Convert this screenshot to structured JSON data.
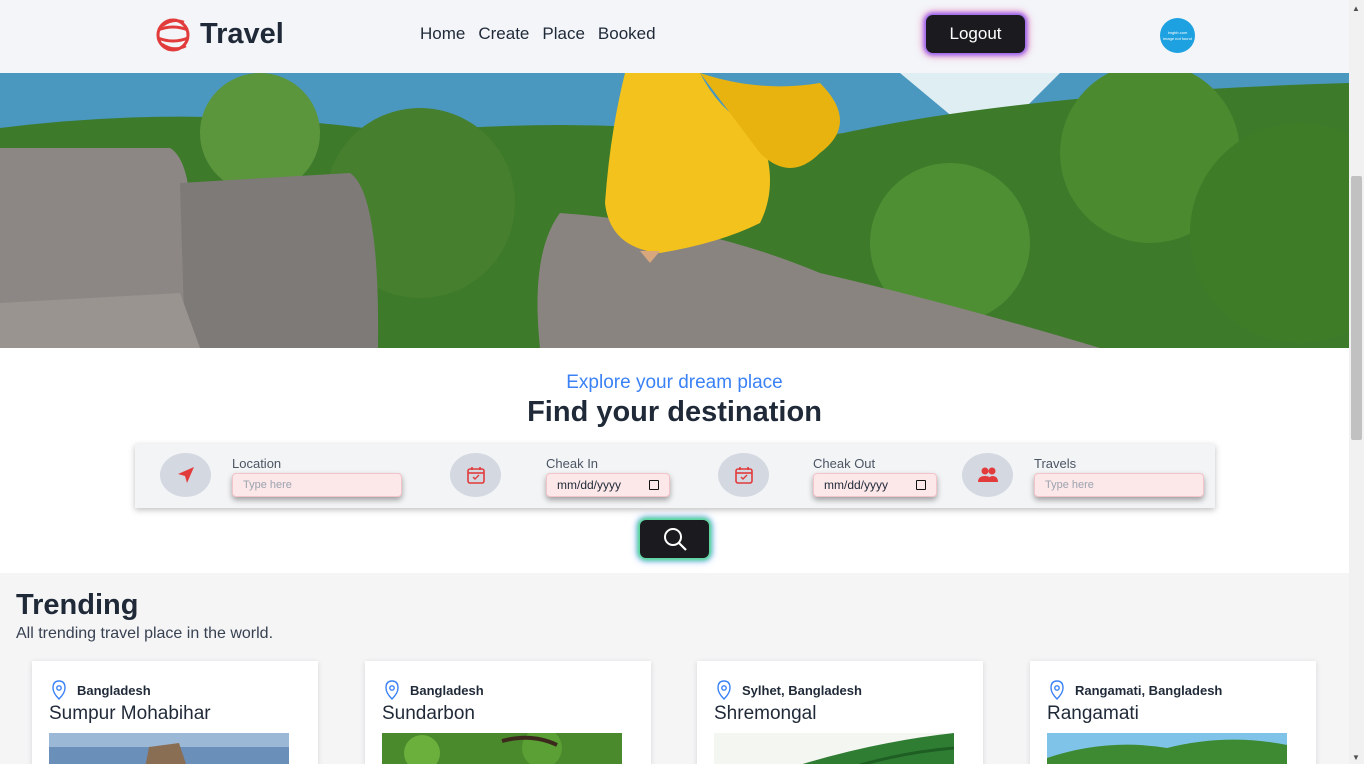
{
  "navbar": {
    "brand": "Travel",
    "links": [
      "Home",
      "Create",
      "Place",
      "Booked"
    ],
    "logout_label": "Logout",
    "avatar_text_1": "imgbb.com",
    "avatar_text_2": "image not found"
  },
  "search_section": {
    "tagline": "Explore your dream place",
    "heading": "Find your destination",
    "location": {
      "label": "Location",
      "placeholder": "Type here"
    },
    "check_in": {
      "label": "Cheak In",
      "value": "mm/dd/yyyy"
    },
    "check_out": {
      "label": "Cheak Out",
      "value": "mm/dd/yyyy"
    },
    "travelers": {
      "label": "Travels",
      "placeholder": "Type here"
    }
  },
  "trending": {
    "title": "Trending",
    "subtitle": "All trending travel place in the world.",
    "cards": [
      {
        "location": "Bangladesh",
        "name": "Sumpur Mohabihar"
      },
      {
        "location": "Bangladesh",
        "name": "Sundarbon"
      },
      {
        "location": "Sylhet, Bangladesh",
        "name": "Shremongal"
      },
      {
        "location": "Rangamati, Bangladesh",
        "name": "Rangamati"
      }
    ]
  },
  "colors": {
    "accent_blue": "#3b82f6",
    "icon_red": "#e23b3b",
    "button_dark": "#1b1b1f"
  }
}
